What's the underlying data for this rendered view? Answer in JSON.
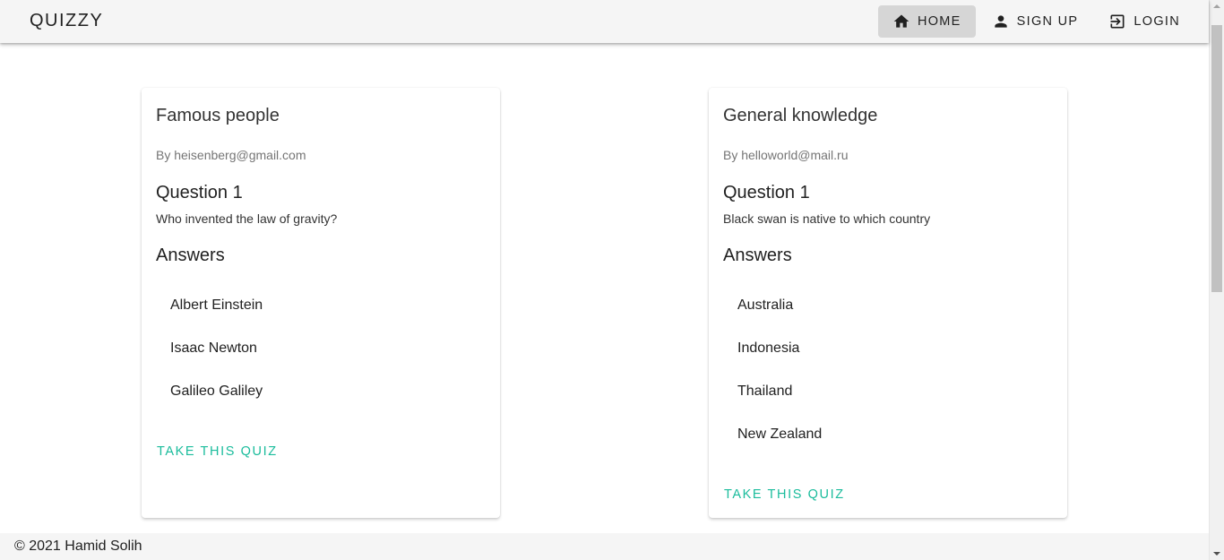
{
  "app": {
    "brand": "QUIZZY"
  },
  "nav": {
    "items": [
      {
        "label": "HOME",
        "icon": "home-icon",
        "active": true
      },
      {
        "label": "SIGN UP",
        "icon": "person-icon",
        "active": false
      },
      {
        "label": "LOGIN",
        "icon": "login-icon",
        "active": false
      }
    ]
  },
  "quizzes": [
    {
      "title": "Famous people",
      "author": "By heisenberg@gmail.com",
      "question_heading": "Question 1",
      "question": "Who invented the law of gravity?",
      "answers_heading": "Answers",
      "answers": [
        "Albert Einstein",
        "Isaac Newton",
        "Galileo Galiley"
      ],
      "action": "TAKE THIS QUIZ"
    },
    {
      "title": "General knowledge",
      "author": "By helloworld@mail.ru",
      "question_heading": "Question 1",
      "question": "Black swan is native to which country",
      "answers_heading": "Answers",
      "answers": [
        "Australia",
        "Indonesia",
        "Thailand",
        "New Zealand"
      ],
      "action": "TAKE THIS QUIZ"
    }
  ],
  "footer": {
    "text": "© 2021 Hamid Solih"
  },
  "colors": {
    "accent": "#1abc9c",
    "app_bar": "#f5f5f5",
    "active_nav": "#d6d6d6"
  }
}
